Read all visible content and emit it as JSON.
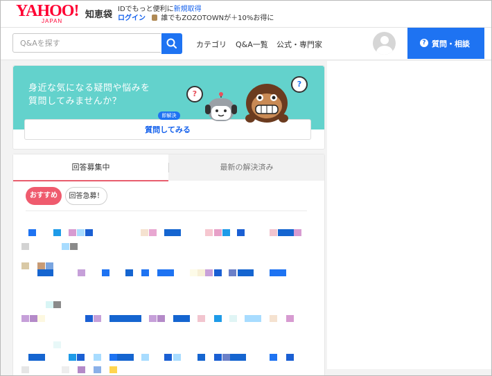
{
  "header": {
    "logo_main": "YAHOO!",
    "logo_sub": "JAPAN",
    "service_name": "知恵袋",
    "promo_prefix": "IDでもっと便利に",
    "promo_link": "新規取得",
    "login_label": "ログイン",
    "zozo_message": "誰でもZOZOTOWNが＋10%お得に"
  },
  "nav": {
    "search_placeholder": "Q&Aを探す",
    "links": [
      "カテゴリ",
      "Q&A一覧",
      "公式・専門家"
    ],
    "ask_button": "質問・相談"
  },
  "banner": {
    "text_line1": "身近な気になる疑問や悩みを",
    "text_line2": "質問してみませんか？",
    "badge": "即解決",
    "cta": "質問してみる",
    "bubble_mark": "?"
  },
  "question_list": {
    "tabs": [
      "回答募集中",
      "最新の解決済み"
    ],
    "active_tab": 0,
    "filters": [
      "おすすめ",
      "回答急募！"
    ],
    "active_filter": 0
  },
  "colors": {
    "brand_red": "#ff0033",
    "link_blue": "#1360ec",
    "primary_blue": "#1e73f2",
    "banner_teal": "#63d2cc",
    "tab_accent": "#e85c6d",
    "pill_pink": "#ef5b6e"
  },
  "icons": [
    "search-icon",
    "question-circle-icon",
    "avatar-icon",
    "bag-icon"
  ]
}
